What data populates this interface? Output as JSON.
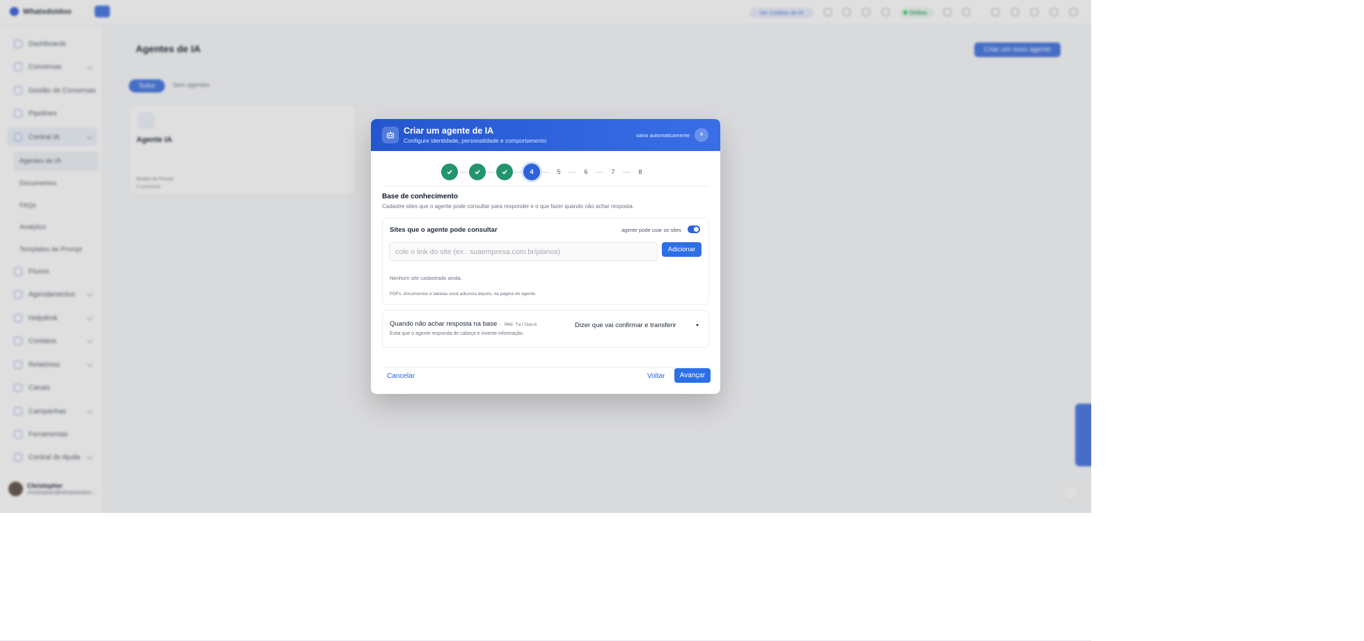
{
  "app": {
    "brand": "Whatsdoidoo",
    "ai_pill": "Ver créditos de IA",
    "status": "Online",
    "page_title": "Agentes de IA",
    "new_agent_button": "Criar um novo agente",
    "filters": {
      "all": "Todos",
      "no_agents": "Sem agentes"
    },
    "sidebar": {
      "items": [
        {
          "label": "Dashboards"
        },
        {
          "label": "Conversas"
        },
        {
          "label": "Gestão de Conversas"
        },
        {
          "label": "Pipelines"
        },
        {
          "label": "Central IA"
        },
        {
          "label": "Fluxos"
        },
        {
          "label": "Agendamentos"
        },
        {
          "label": "Helpdesk"
        },
        {
          "label": "Contatos"
        },
        {
          "label": "Relatórios"
        },
        {
          "label": "Canais"
        },
        {
          "label": "Campanhas"
        },
        {
          "label": "Ferramentas"
        },
        {
          "label": "Central de Ajuda"
        }
      ],
      "subitems": [
        {
          "label": "Agentes de IA"
        },
        {
          "label": "Documentos"
        },
        {
          "label": "FAQs"
        },
        {
          "label": "Analytics"
        },
        {
          "label": "Templates de Prompt"
        }
      ]
    },
    "user": {
      "name": "Christopher",
      "email": "christopher@whatsdoidoo..."
    },
    "agent_card": {
      "name": "Agente IA",
      "meta1": "Modelo de Prompt",
      "meta2": "0 conversas"
    }
  },
  "modal": {
    "title": "Criar um agente de IA",
    "subtitle": "Configure identidade, personalidade e comportamento",
    "saved": "salvo automaticamente",
    "close": "×",
    "steps": {
      "current": "4",
      "future": [
        "5",
        "6",
        "7",
        "8"
      ]
    },
    "section": {
      "title": "Base de conhecimento",
      "description": "Cadastre sites que o agente pode consultar para responder e o que fazer quando não achar resposta."
    },
    "sites_panel": {
      "title": "Sites que o agente pode consultar",
      "toggle_label": "agente pode usar os sites",
      "toggle_on": true,
      "input_placeholder": "cole o link do site (ex.: suaempresa.com.br/planos)",
      "input_value": "",
      "add_button": "Adicionar",
      "empty_text": "Nenhum site cadastrado ainda.",
      "note": "PDFs, documentos e tabelas você adiciona depois, na página do agente."
    },
    "fallback_panel": {
      "title": "Quando não achar resposta na base",
      "tag": "· RAG fallback",
      "description": "Evita que o agente responda de cabeça e invente informação.",
      "selected_option": "Dizer que vai confirmar e transferir"
    },
    "footer": {
      "cancel": "Cancelar",
      "back": "Voltar",
      "next": "Avançar"
    }
  },
  "colors": {
    "primary": "#2c62dc",
    "header_gradient_start": "#2456cf",
    "header_gradient_end": "#3a6ee6",
    "step_done": "#22946e",
    "text_dark": "#111827",
    "text_muted": "#6b7280"
  },
  "icons": {
    "modal": "robot-icon",
    "close": "close-icon",
    "step_done": "check-icon"
  }
}
